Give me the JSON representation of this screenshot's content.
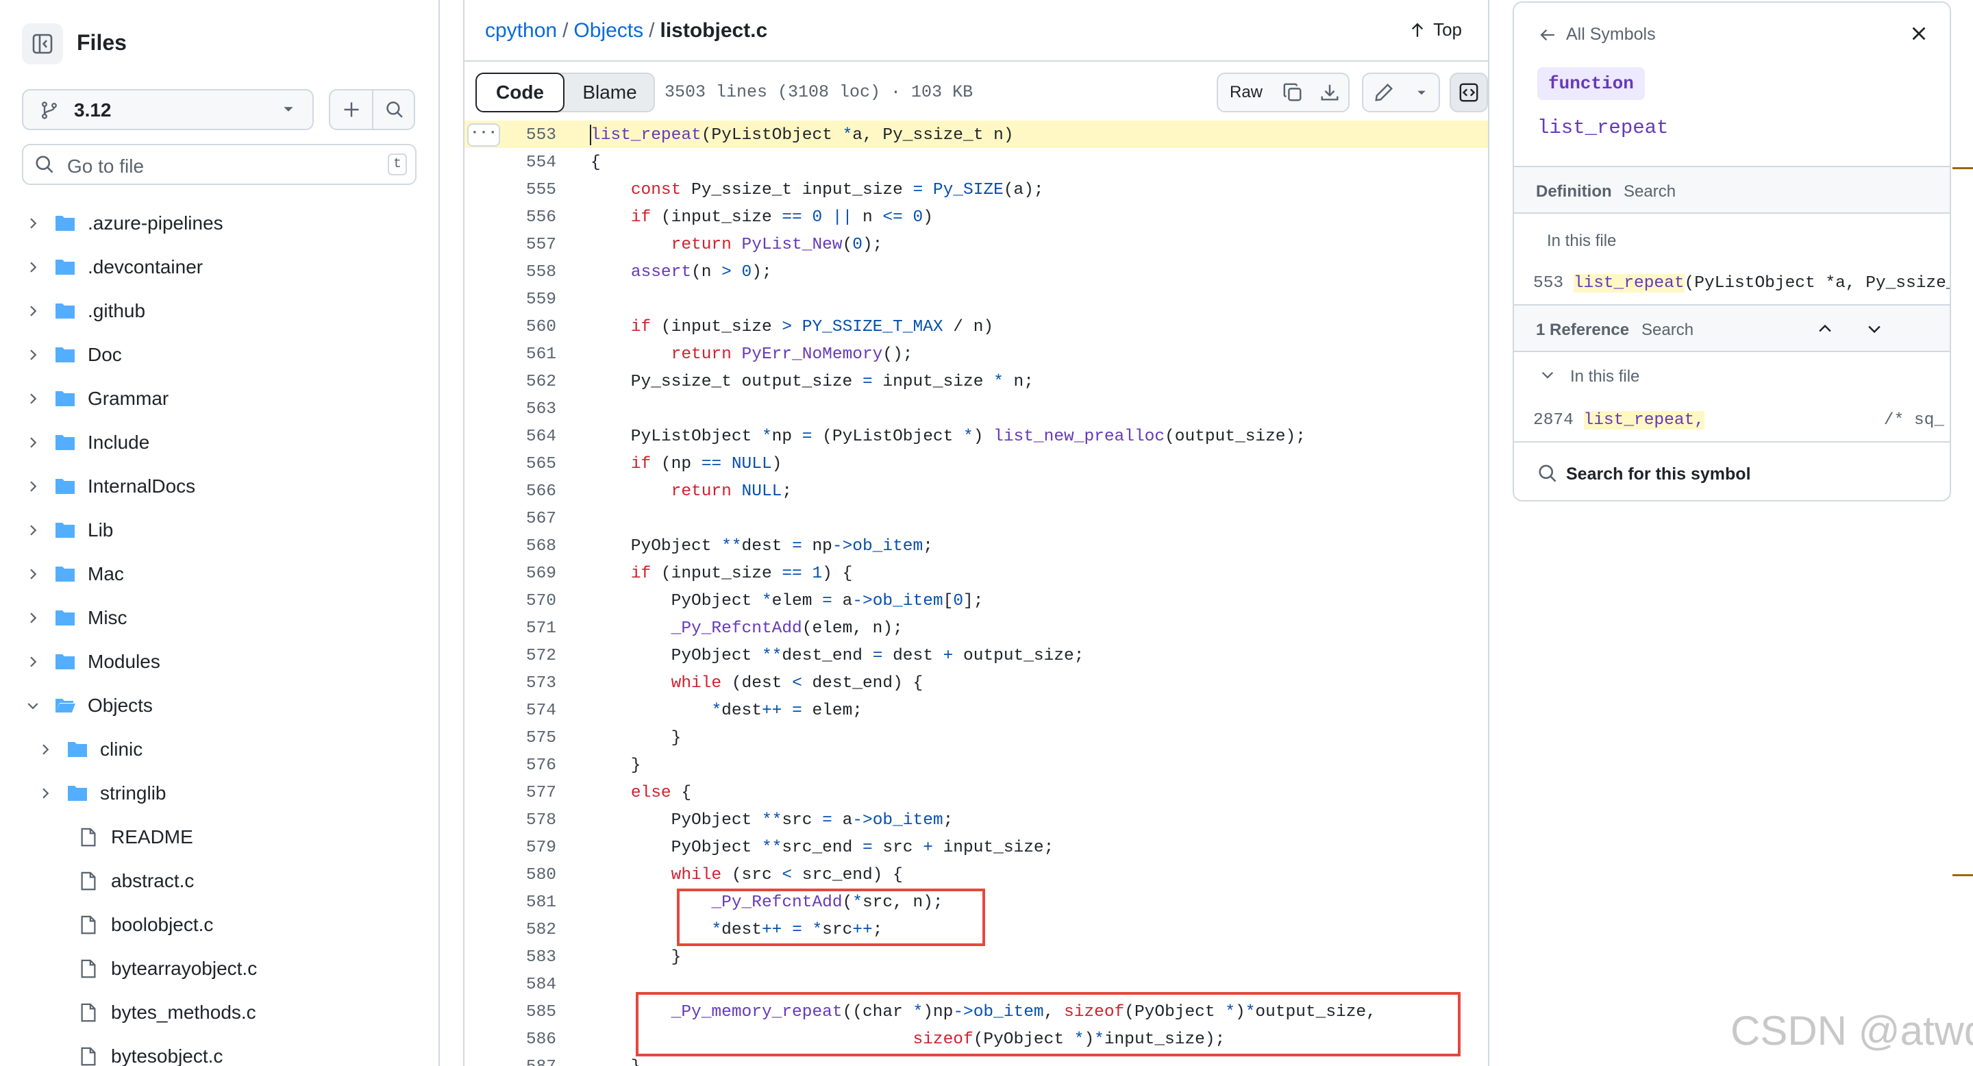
{
  "sidebar": {
    "title": "Files",
    "branch": "3.12",
    "goto_placeholder": "Go to file",
    "goto_shortcut": "t",
    "tree": [
      {
        "label": ".azure-pipelines",
        "type": "folder",
        "depth": 0,
        "expanded": false
      },
      {
        "label": ".devcontainer",
        "type": "folder",
        "depth": 0,
        "expanded": false
      },
      {
        "label": ".github",
        "type": "folder",
        "depth": 0,
        "expanded": false
      },
      {
        "label": "Doc",
        "type": "folder",
        "depth": 0,
        "expanded": false
      },
      {
        "label": "Grammar",
        "type": "folder",
        "depth": 0,
        "expanded": false
      },
      {
        "label": "Include",
        "type": "folder",
        "depth": 0,
        "expanded": false
      },
      {
        "label": "InternalDocs",
        "type": "folder",
        "depth": 0,
        "expanded": false
      },
      {
        "label": "Lib",
        "type": "folder",
        "depth": 0,
        "expanded": false
      },
      {
        "label": "Mac",
        "type": "folder",
        "depth": 0,
        "expanded": false
      },
      {
        "label": "Misc",
        "type": "folder",
        "depth": 0,
        "expanded": false
      },
      {
        "label": "Modules",
        "type": "folder",
        "depth": 0,
        "expanded": false
      },
      {
        "label": "Objects",
        "type": "folder",
        "depth": 0,
        "expanded": true
      },
      {
        "label": "clinic",
        "type": "folder",
        "depth": 1,
        "expanded": false
      },
      {
        "label": "stringlib",
        "type": "folder",
        "depth": 1,
        "expanded": false
      },
      {
        "label": "README",
        "type": "file",
        "depth": 1
      },
      {
        "label": "abstract.c",
        "type": "file",
        "depth": 1
      },
      {
        "label": "boolobject.c",
        "type": "file",
        "depth": 1
      },
      {
        "label": "bytearrayobject.c",
        "type": "file",
        "depth": 1
      },
      {
        "label": "bytes_methods.c",
        "type": "file",
        "depth": 1
      },
      {
        "label": "bytesobject.c",
        "type": "file",
        "depth": 1
      }
    ]
  },
  "header": {
    "breadcrumb": {
      "repo": "cpython",
      "sep": "/",
      "folder": "Objects",
      "file": "listobject.c"
    },
    "top_label": "Top"
  },
  "toolbar": {
    "code_tab": "Code",
    "blame_tab": "Blame",
    "file_info": "3503 lines (3108 loc) · 103 KB",
    "raw_label": "Raw"
  },
  "code": {
    "dots": "···",
    "lines": [
      {
        "n": "553",
        "tokens": [
          [
            "f",
            "list_repeat"
          ],
          [
            "",
            "(PyListObject "
          ],
          [
            "c",
            "*"
          ],
          [
            "",
            "a, Py_ssize_t n)"
          ]
        ]
      },
      {
        "n": "554",
        "tokens": [
          [
            "",
            "{"
          ]
        ]
      },
      {
        "n": "555",
        "tokens": [
          [
            "",
            "    "
          ],
          [
            "k",
            "const"
          ],
          [
            "",
            " Py_ssize_t input_size "
          ],
          [
            "c",
            "="
          ],
          [
            "",
            " "
          ],
          [
            "c",
            "Py_SIZE"
          ],
          [
            "",
            "(a);"
          ]
        ]
      },
      {
        "n": "556",
        "tokens": [
          [
            "",
            "    "
          ],
          [
            "k",
            "if"
          ],
          [
            "",
            " (input_size "
          ],
          [
            "c",
            "=="
          ],
          [
            "",
            " "
          ],
          [
            "c",
            "0"
          ],
          [
            "",
            " "
          ],
          [
            "c",
            "||"
          ],
          [
            "",
            " n "
          ],
          [
            "c",
            "<="
          ],
          [
            "",
            " "
          ],
          [
            "c",
            "0"
          ],
          [
            "",
            ")"
          ]
        ]
      },
      {
        "n": "557",
        "tokens": [
          [
            "",
            "        "
          ],
          [
            "k",
            "return"
          ],
          [
            "",
            " "
          ],
          [
            "f",
            "PyList_New"
          ],
          [
            "",
            "("
          ],
          [
            "c",
            "0"
          ],
          [
            "",
            ");"
          ]
        ]
      },
      {
        "n": "558",
        "tokens": [
          [
            "",
            "    "
          ],
          [
            "f",
            "assert"
          ],
          [
            "",
            "(n "
          ],
          [
            "c",
            ">"
          ],
          [
            "",
            " "
          ],
          [
            "c",
            "0"
          ],
          [
            "",
            ");"
          ]
        ]
      },
      {
        "n": "559",
        "tokens": [
          [
            "",
            ""
          ]
        ]
      },
      {
        "n": "560",
        "tokens": [
          [
            "",
            "    "
          ],
          [
            "k",
            "if"
          ],
          [
            "",
            " (input_size "
          ],
          [
            "c",
            ">"
          ],
          [
            "",
            " "
          ],
          [
            "c",
            "PY_SSIZE_T_MAX"
          ],
          [
            "",
            " / n)"
          ]
        ]
      },
      {
        "n": "561",
        "tokens": [
          [
            "",
            "        "
          ],
          [
            "k",
            "return"
          ],
          [
            "",
            " "
          ],
          [
            "f",
            "PyErr_NoMemory"
          ],
          [
            "",
            "();"
          ]
        ]
      },
      {
        "n": "562",
        "tokens": [
          [
            "",
            "    Py_ssize_t output_size "
          ],
          [
            "c",
            "="
          ],
          [
            "",
            " input_size "
          ],
          [
            "c",
            "*"
          ],
          [
            "",
            " n;"
          ]
        ]
      },
      {
        "n": "563",
        "tokens": [
          [
            "",
            ""
          ]
        ]
      },
      {
        "n": "564",
        "tokens": [
          [
            "",
            "    PyListObject "
          ],
          [
            "c",
            "*"
          ],
          [
            "",
            "np "
          ],
          [
            "c",
            "="
          ],
          [
            "",
            " (PyListObject "
          ],
          [
            "c",
            "*"
          ],
          [
            "",
            ") "
          ],
          [
            "f",
            "list_new_prealloc"
          ],
          [
            "",
            "(output_size);"
          ]
        ]
      },
      {
        "n": "565",
        "tokens": [
          [
            "",
            "    "
          ],
          [
            "k",
            "if"
          ],
          [
            "",
            " (np "
          ],
          [
            "c",
            "=="
          ],
          [
            "",
            " "
          ],
          [
            "c",
            "NULL"
          ],
          [
            "",
            ")"
          ]
        ]
      },
      {
        "n": "566",
        "tokens": [
          [
            "",
            "        "
          ],
          [
            "k",
            "return"
          ],
          [
            "",
            " "
          ],
          [
            "c",
            "NULL"
          ],
          [
            "",
            ";"
          ]
        ]
      },
      {
        "n": "567",
        "tokens": [
          [
            "",
            ""
          ]
        ]
      },
      {
        "n": "568",
        "tokens": [
          [
            "",
            "    PyObject "
          ],
          [
            "c",
            "**"
          ],
          [
            "",
            "dest "
          ],
          [
            "c",
            "="
          ],
          [
            "",
            " np"
          ],
          [
            "c",
            "->"
          ],
          [
            "c",
            "ob_item"
          ],
          [
            "",
            ";"
          ]
        ]
      },
      {
        "n": "569",
        "tokens": [
          [
            "",
            "    "
          ],
          [
            "k",
            "if"
          ],
          [
            "",
            " (input_size "
          ],
          [
            "c",
            "=="
          ],
          [
            "",
            " "
          ],
          [
            "c",
            "1"
          ],
          [
            "",
            ") {"
          ]
        ]
      },
      {
        "n": "570",
        "tokens": [
          [
            "",
            "        PyObject "
          ],
          [
            "c",
            "*"
          ],
          [
            "",
            "elem "
          ],
          [
            "c",
            "="
          ],
          [
            "",
            " a"
          ],
          [
            "c",
            "->"
          ],
          [
            "c",
            "ob_item"
          ],
          [
            "",
            "["
          ],
          [
            "c",
            "0"
          ],
          [
            "",
            "];"
          ]
        ]
      },
      {
        "n": "571",
        "tokens": [
          [
            "",
            "        "
          ],
          [
            "f",
            "_Py_RefcntAdd"
          ],
          [
            "",
            "(elem, n);"
          ]
        ]
      },
      {
        "n": "572",
        "tokens": [
          [
            "",
            "        PyObject "
          ],
          [
            "c",
            "**"
          ],
          [
            "",
            "dest_end "
          ],
          [
            "c",
            "="
          ],
          [
            "",
            " dest "
          ],
          [
            "c",
            "+"
          ],
          [
            "",
            " output_size;"
          ]
        ]
      },
      {
        "n": "573",
        "tokens": [
          [
            "",
            "        "
          ],
          [
            "k",
            "while"
          ],
          [
            "",
            " (dest "
          ],
          [
            "c",
            "<"
          ],
          [
            "",
            " dest_end) {"
          ]
        ]
      },
      {
        "n": "574",
        "tokens": [
          [
            "",
            "            "
          ],
          [
            "c",
            "*"
          ],
          [
            "",
            "dest"
          ],
          [
            "c",
            "++"
          ],
          [
            "",
            " "
          ],
          [
            "c",
            "="
          ],
          [
            "",
            " elem;"
          ]
        ]
      },
      {
        "n": "575",
        "tokens": [
          [
            "",
            "        }"
          ]
        ]
      },
      {
        "n": "576",
        "tokens": [
          [
            "",
            "    }"
          ]
        ]
      },
      {
        "n": "577",
        "tokens": [
          [
            "",
            "    "
          ],
          [
            "k",
            "else"
          ],
          [
            "",
            " {"
          ]
        ]
      },
      {
        "n": "578",
        "tokens": [
          [
            "",
            "        PyObject "
          ],
          [
            "c",
            "**"
          ],
          [
            "",
            "src "
          ],
          [
            "c",
            "="
          ],
          [
            "",
            " a"
          ],
          [
            "c",
            "->"
          ],
          [
            "c",
            "ob_item"
          ],
          [
            "",
            ";"
          ]
        ]
      },
      {
        "n": "579",
        "tokens": [
          [
            "",
            "        PyObject "
          ],
          [
            "c",
            "**"
          ],
          [
            "",
            "src_end "
          ],
          [
            "c",
            "="
          ],
          [
            "",
            " src "
          ],
          [
            "c",
            "+"
          ],
          [
            "",
            " input_size;"
          ]
        ]
      },
      {
        "n": "580",
        "tokens": [
          [
            "",
            "        "
          ],
          [
            "k",
            "while"
          ],
          [
            "",
            " (src "
          ],
          [
            "c",
            "<"
          ],
          [
            "",
            " src_end) {"
          ]
        ]
      },
      {
        "n": "581",
        "tokens": [
          [
            "",
            "            "
          ],
          [
            "f",
            "_Py_RefcntAdd"
          ],
          [
            "",
            "("
          ],
          [
            "c",
            "*"
          ],
          [
            "",
            "src, n);"
          ]
        ]
      },
      {
        "n": "582",
        "tokens": [
          [
            "",
            "            "
          ],
          [
            "c",
            "*"
          ],
          [
            "",
            "dest"
          ],
          [
            "c",
            "++"
          ],
          [
            "",
            " "
          ],
          [
            "c",
            "="
          ],
          [
            "",
            " "
          ],
          [
            "c",
            "*"
          ],
          [
            "",
            "src"
          ],
          [
            "c",
            "++"
          ],
          [
            "",
            ";"
          ]
        ]
      },
      {
        "n": "583",
        "tokens": [
          [
            "",
            "        }"
          ]
        ]
      },
      {
        "n": "584",
        "tokens": [
          [
            "",
            ""
          ]
        ]
      },
      {
        "n": "585",
        "tokens": [
          [
            "",
            "        "
          ],
          [
            "f",
            "_Py_memory_repeat"
          ],
          [
            "",
            "((char "
          ],
          [
            "c",
            "*"
          ],
          [
            "",
            ")np"
          ],
          [
            "c",
            "->"
          ],
          [
            "c",
            "ob_item"
          ],
          [
            "",
            ", "
          ],
          [
            "k",
            "sizeof"
          ],
          [
            "",
            "(PyObject "
          ],
          [
            "c",
            "*"
          ],
          [
            "",
            ")"
          ],
          [
            "c",
            "*"
          ],
          [
            "",
            "output_size,"
          ]
        ]
      },
      {
        "n": "586",
        "tokens": [
          [
            "",
            "                                "
          ],
          [
            "k",
            "sizeof"
          ],
          [
            "",
            "(PyObject "
          ],
          [
            "c",
            "*"
          ],
          [
            "",
            ")"
          ],
          [
            "c",
            "*"
          ],
          [
            "",
            "input_size);"
          ]
        ]
      },
      {
        "n": "587",
        "tokens": [
          [
            "",
            "    }"
          ]
        ]
      }
    ]
  },
  "symbols": {
    "back_label": "All Symbols",
    "kind": "function",
    "name": "list_repeat",
    "definition_title": "Definition",
    "definition_search": "Search",
    "definition_scope": "In this file",
    "definition_line_no": "553",
    "definition_match": "list_repeat",
    "definition_rest": "(PyListObject *a, Py_ssize_",
    "reference_title": "1 Reference",
    "reference_search": "Search",
    "reference_scope": "In this file",
    "reference_line_no": "2874",
    "reference_match": "list_repeat,",
    "reference_rest": "/* sq_",
    "search_symbol": "Search for this symbol"
  },
  "watermark": "CSDN @atwdy",
  "colors": {
    "link": "#0969da",
    "keyword": "#cf222e",
    "function": "#6639ba",
    "constant": "#0550ae",
    "highlight": "#fff8c5",
    "annotation_box": "#e5483e"
  }
}
